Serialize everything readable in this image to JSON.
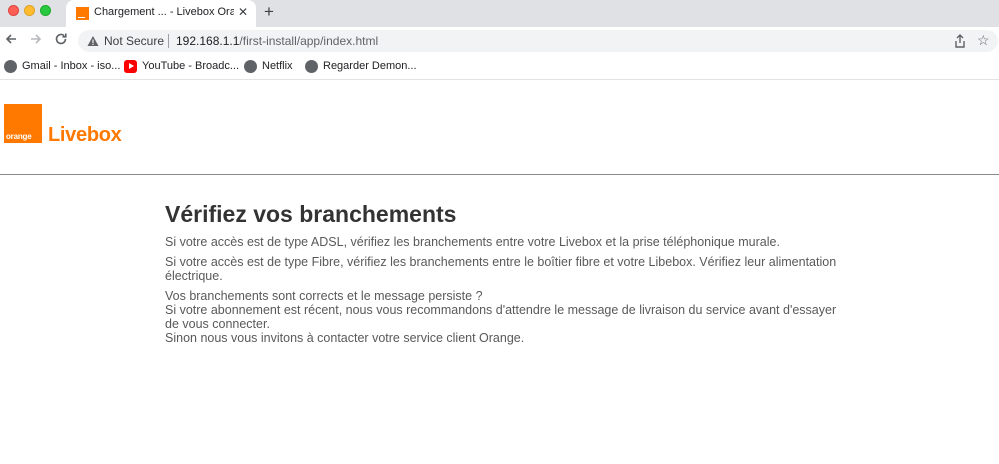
{
  "browser": {
    "tab": {
      "title": "Chargement ... - Livebox Orange"
    },
    "security_label": "Not Secure",
    "url": {
      "host": "192.168.1.1",
      "path": "/first-install/app/index.html"
    },
    "bookmarks": [
      {
        "label": "Gmail - Inbox - iso...",
        "icon": "globe-icon"
      },
      {
        "label": "YouTube - Broadc...",
        "icon": "youtube-icon"
      },
      {
        "label": "Netflix",
        "icon": "globe-icon"
      },
      {
        "label": "Regarder Demon...",
        "icon": "globe-icon"
      }
    ]
  },
  "header": {
    "logo_text": "orange",
    "brand": "Livebox",
    "brand_color": "#ff7900"
  },
  "main": {
    "title": "Vérifiez vos branchements",
    "paragraphs": [
      "Si votre accès est de type ADSL, vérifiez les branchements entre votre Livebox et la prise téléphonique murale.",
      "Si votre accès est de type Fibre, vérifiez les branchements entre le boîtier fibre et votre Libebox. Vérifiez leur alimentation électrique."
    ],
    "help_lines": [
      "Vos branchements sont corrects et le message persiste ?",
      "Si votre abonnement est récent, nous vous recommandons d'attendre le message de livraison du service avant d'essayer de vous connecter.",
      "Sinon nous vous invitons à contacter votre service client Orange."
    ]
  }
}
